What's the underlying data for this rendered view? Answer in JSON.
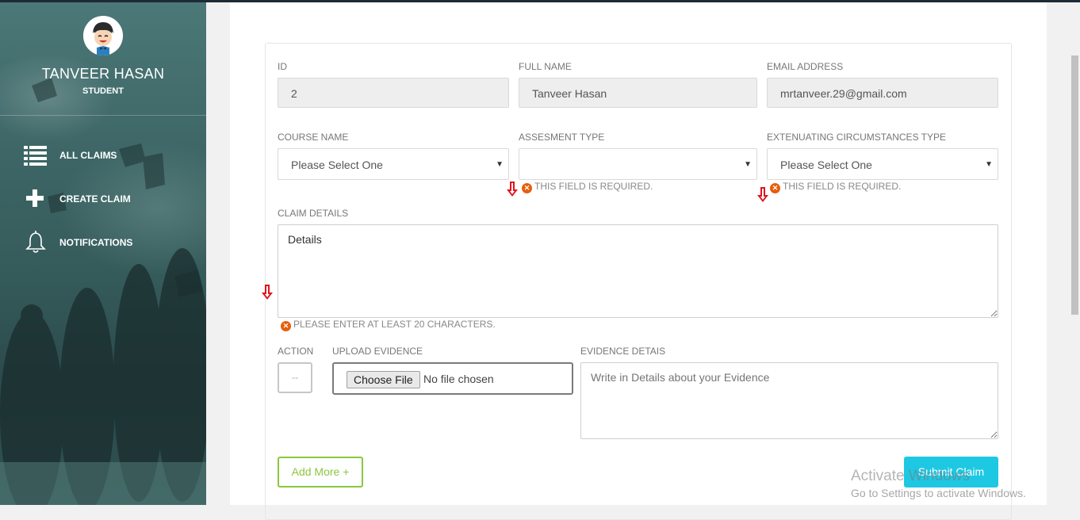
{
  "profile": {
    "name": "TANVEER HASAN",
    "role": "STUDENT"
  },
  "nav": [
    {
      "label": "ALL CLAIMS",
      "icon": "list-icon"
    },
    {
      "label": "CREATE CLAIM",
      "icon": "plus-icon"
    },
    {
      "label": "NOTIFICATIONS",
      "icon": "bell-icon"
    }
  ],
  "form": {
    "id": {
      "label": "ID",
      "value": "2"
    },
    "full_name": {
      "label": "FULL NAME",
      "value": "Tanveer Hasan"
    },
    "email": {
      "label": "EMAIL ADDRESS",
      "value": "mrtanveer.29@gmail.com"
    },
    "course": {
      "label": "COURSE NAME",
      "value": "Please Select One"
    },
    "assessment": {
      "label": "ASSESMENT TYPE",
      "value": "",
      "error": "THIS FIELD IS REQUIRED."
    },
    "extenuating": {
      "label": "EXTENUATING CIRCUMSTANCES TYPE",
      "value": "Please Select One",
      "error": "THIS FIELD IS REQUIRED."
    },
    "claim_details": {
      "label": "CLAIM DETAILS",
      "value": "Details",
      "error": "PLEASE ENTER AT LEAST 20 CHARACTERS."
    },
    "action": {
      "label": "ACTION",
      "button": "--"
    },
    "upload": {
      "label": "UPLOAD EVIDENCE",
      "button": "Choose File",
      "status": "No file chosen"
    },
    "evidence": {
      "label": "EVIDENCE DETAIS",
      "placeholder": "Write in Details about your Evidence"
    },
    "add_more": "Add More +",
    "submit": "Submit Claim"
  },
  "watermark": {
    "line1": "Activate Windows",
    "line2": "Go to Settings to activate Windows."
  },
  "colors": {
    "accent_green": "#8cc63f",
    "submit_cyan": "#1ec8e3",
    "error_orange": "#e85d0c",
    "sidebar_teal": "#3e6666"
  }
}
